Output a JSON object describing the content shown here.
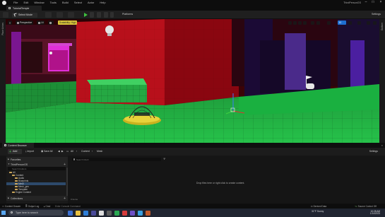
{
  "app": {
    "menus": [
      "File",
      "Edit",
      "Window",
      "Tools",
      "Build",
      "Select",
      "Actor",
      "Help"
    ],
    "project_name": "ThirdPersonGS",
    "level_tab": "TutorialTemple"
  },
  "toolbar": {
    "select_mode": "Select Mode",
    "platforms": "Platforms",
    "settings": "Settings"
  },
  "side": {
    "left_label": "Place Actors",
    "right_label": "Outliner"
  },
  "viewport": {
    "view_mode": "Perspective",
    "lighting": "Lit",
    "scalability": "Scalability: High",
    "grid_size": "10"
  },
  "content_browser": {
    "tab_title": "Content Browser",
    "add_label": "Add",
    "import_label": "Import",
    "save_all_label": "Save All",
    "path_all": "All",
    "path_content": "Content",
    "path_mesh": "Mesh",
    "settings_label": "Settings",
    "favorites_label": "Favorites",
    "project_label": "ThirdPersonGS",
    "search_folders_placeholder": "Search Folders",
    "search_mesh_placeholder": "Search Mesh",
    "tree": [
      "All",
      "Content",
      "Audio",
      "Blueprints",
      "Mesh",
      "Mesh_geo",
      "Template",
      "Engine Content"
    ],
    "collections_label": "Collections",
    "drop_hint": "Drop files here or right click to create content.",
    "items_count": "0 items"
  },
  "statusbar": {
    "content_drawer": "Content Drawer",
    "output_log": "Output Log",
    "cmd": "Cmd",
    "console_placeholder": "Enter Console Command",
    "derived_data": "Derived Data",
    "source_control": "Source Control Off"
  },
  "taskbar": {
    "search_placeholder": "Type here to search",
    "weather_temp": "31°F",
    "weather_desc": "Sunny",
    "time": "10:28 AM",
    "date": "1/14/2023"
  }
}
